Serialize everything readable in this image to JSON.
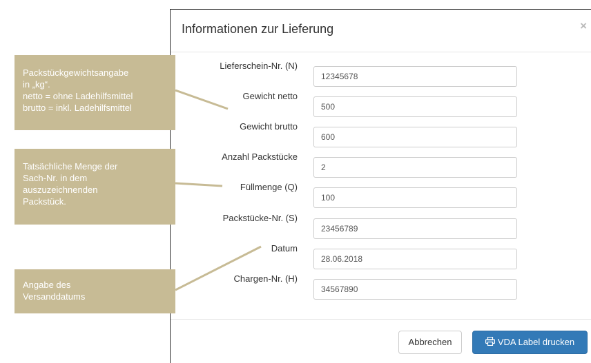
{
  "modal": {
    "title": "Informationen zur Lieferung",
    "close_icon": "×",
    "fields": [
      {
        "label": "Lieferschein-Nr. (N)",
        "value": "12345678"
      },
      {
        "label": "Gewicht netto",
        "value": "500"
      },
      {
        "label": "Gewicht brutto",
        "value": "600"
      },
      {
        "label": "Anzahl Packstücke",
        "value": "2"
      },
      {
        "label": "Füllmenge (Q)",
        "value": "100"
      },
      {
        "label": "Packstücke-Nr. (S)",
        "value": "23456789"
      },
      {
        "label": "Datum",
        "value": "28.06.2018"
      },
      {
        "label": "Chargen-Nr. (H)",
        "value": "34567890"
      }
    ],
    "cancel_label": "Abbrechen",
    "print_label": "VDA Label drucken",
    "print_icon": "printer-icon"
  },
  "annotations": [
    {
      "lines": [
        "Packstückgewichtsangabe",
        "in „kg“.",
        "netto = ohne Ladehilfsmittel",
        "brutto = inkl. Ladehilfsmittel"
      ]
    },
    {
      "lines": [
        "Tatsächliche Menge der",
        "Sach-Nr. in dem",
        "auszuzeichnenden",
        "Packstück."
      ]
    },
    {
      "lines": [
        "Angabe des",
        "Versanddatums"
      ]
    }
  ],
  "colors": {
    "annotation": "#c7bb95",
    "primary": "#337ab7"
  }
}
